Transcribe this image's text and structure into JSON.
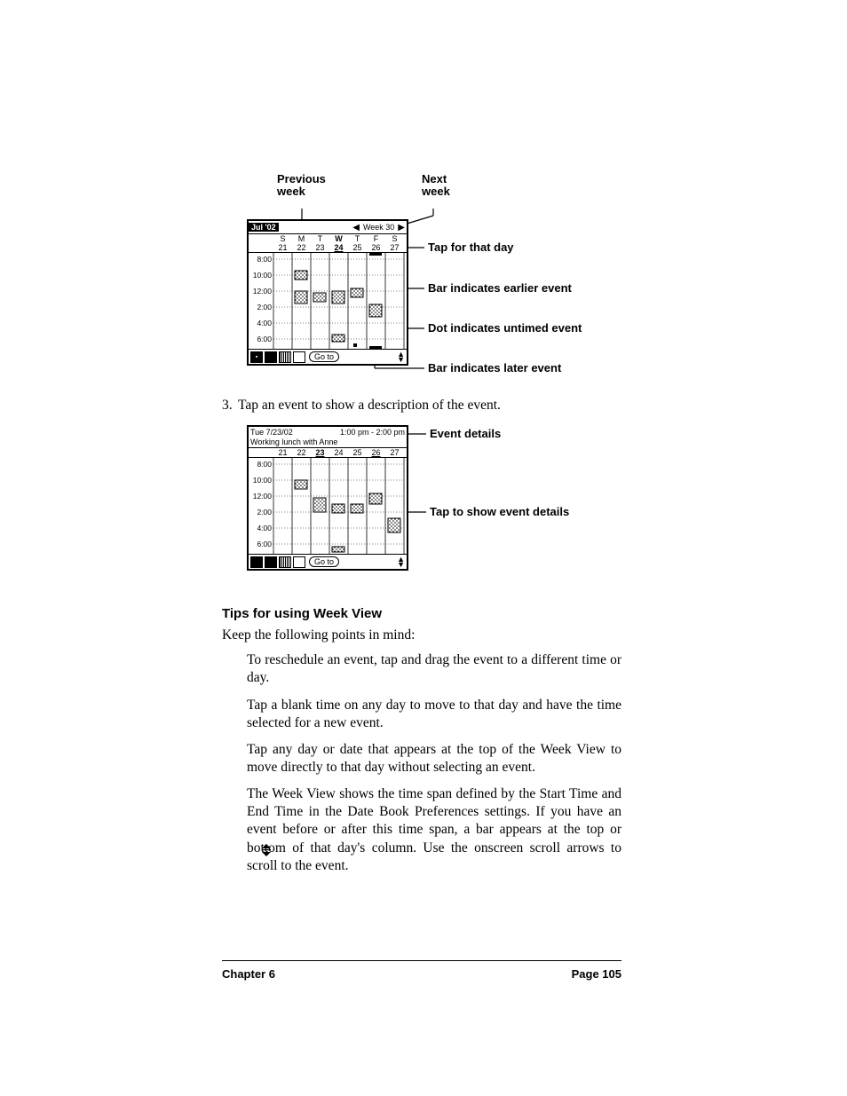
{
  "callouts_top": {
    "previous_week": "Previous\nweek",
    "next_week": "Next\nweek"
  },
  "figure1": {
    "month_badge": "Jul '02",
    "week_label": "Week 30",
    "day_letters": [
      "S",
      "M",
      "T",
      "W",
      "T",
      "F",
      "S"
    ],
    "day_numbers": [
      "21",
      "22",
      "23",
      "24",
      "25",
      "26",
      "27"
    ],
    "times": [
      "8:00",
      "10:00",
      "12:00",
      "2:00",
      "4:00",
      "6:00"
    ],
    "goto": "Go to",
    "callout_tap_day": "Tap for that day",
    "callout_earlier": "Bar indicates earlier event",
    "callout_untimed": "Dot indicates untimed event",
    "callout_later": "Bar indicates later event"
  },
  "step3": "Tap an event to show a description of the event.",
  "figure2": {
    "date": "Tue 7/23/02",
    "timerange": "1:00 pm - 2:00 pm",
    "event_title": "Working lunch with Anne",
    "day_numbers": [
      "21",
      "22",
      "23",
      "24",
      "25",
      "26",
      "27"
    ],
    "times": [
      "8:00",
      "10:00",
      "12:00",
      "2:00",
      "4:00",
      "6:00"
    ],
    "goto": "Go to",
    "callout_details": "Event details",
    "callout_tap_show": "Tap to show event details"
  },
  "tips_heading": "Tips for using Week View",
  "tips_intro": "Keep the following points in mind:",
  "tips": [
    "To reschedule an event, tap and drag the event to a different time or day.",
    "Tap a blank time on any day to move to that day and have the time selected for a new event.",
    "Tap any day or date that appears at the top of the Week View to move directly to that day without selecting an event.",
    "The Week View shows the time span defined by the Start Time and End Time in the Date Book Preferences settings. If you have an event before or after this time span, a bar appears at the top or bottom of that day's column. Use the onscreen scroll arrows  to scroll to the event."
  ],
  "footer": {
    "chapter": "Chapter 6",
    "page": "Page 105"
  }
}
